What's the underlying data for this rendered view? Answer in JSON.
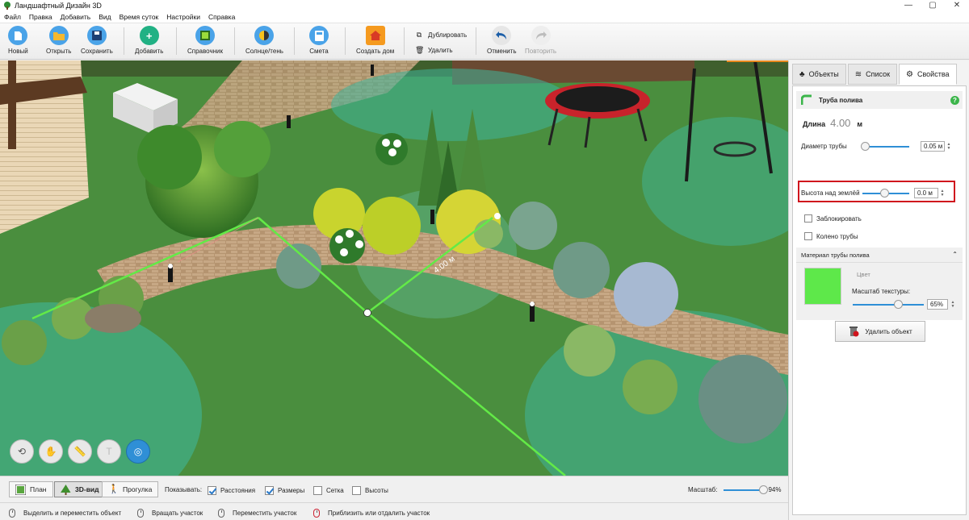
{
  "window": {
    "title": "Ландшафтный Дизайн 3D",
    "controls": [
      "—",
      "▢",
      "✕"
    ]
  },
  "menu": [
    "Файл",
    "Правка",
    "Добавить",
    "Вид",
    "Время суток",
    "Настройки",
    "Справка"
  ],
  "toolbar": {
    "new": "Новый",
    "open": "Открыть",
    "save": "Сохранить",
    "add": "Добавить",
    "reference": "Справочник",
    "sun": "Солнце/тень",
    "estimate": "Смета",
    "house": "Создать дом",
    "duplicate": "Дублировать",
    "delete": "Удалить",
    "undo": "Отменить",
    "redo": "Повторить"
  },
  "scene": {
    "dimension_label": "4.00 м"
  },
  "panel": {
    "tabs": [
      "Объекты",
      "Список",
      "Свойства"
    ],
    "object_name": "Труба полива",
    "help": "?",
    "length_label": "Длина",
    "length_value": "4.00",
    "length_unit": "м",
    "diameter_label": "Диаметр трубы",
    "diameter_value": "0.05 м",
    "height_label": "Высота над землёй",
    "height_value": "0.0 м",
    "lock_label": "Заблокировать",
    "elbow_label": "Колено трубы",
    "material_header": "Материал трубы полива",
    "color_label": "Цвет",
    "texture_scale_label": "Масштаб текстуры:",
    "texture_scale_value": "65%",
    "delete_object": "Удалить объект",
    "material_color": "#5ee84a"
  },
  "bottom": {
    "plan": "План",
    "view3d": "3D-вид",
    "walk": "Прогулка",
    "show_label": "Показывать:",
    "distances": "Расстояния",
    "sizes": "Размеры",
    "grid": "Сетка",
    "heights": "Высоты",
    "zoom_label": "Масштаб:",
    "zoom_value": "94%"
  },
  "status": {
    "select_move": "Выделить и переместить объект",
    "rotate": "Вращать участок",
    "move_area": "Переместить участок",
    "zoom": "Приблизить или отдалить участок"
  }
}
